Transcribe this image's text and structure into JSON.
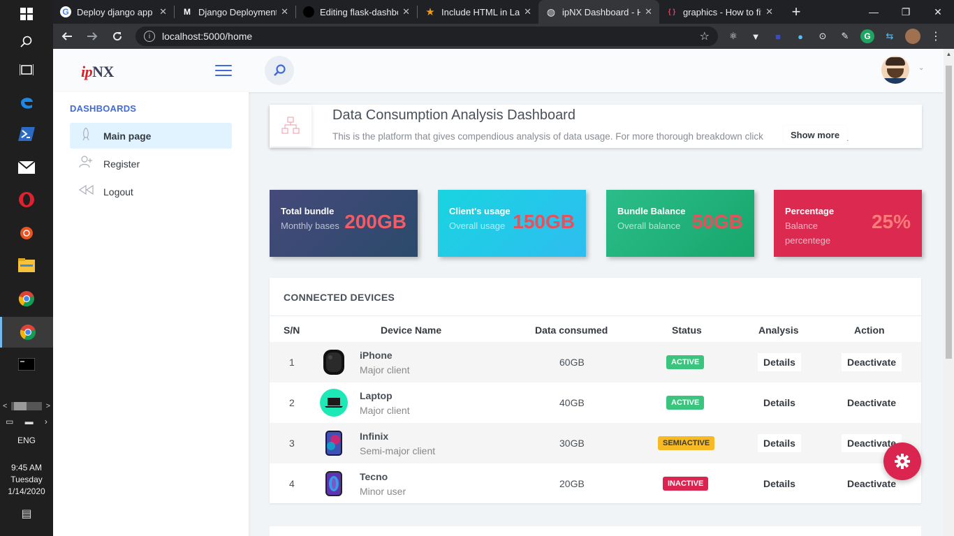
{
  "taskbar": {
    "icons": [
      "windows-icon",
      "search-icon",
      "task-view-icon",
      "edge-icon",
      "powershell-icon",
      "mail-icon",
      "opera-icon",
      "ubuntu-icon",
      "file-explorer-icon",
      "chrome-icon",
      "chrome-active-icon",
      "terminal-icon"
    ],
    "language": "ENG",
    "time": "9:45 AM",
    "day": "Tuesday",
    "date": "1/14/2020"
  },
  "browser": {
    "tabs": [
      {
        "label": "Deploy django app w",
        "favicon": "G"
      },
      {
        "label": "Django Deployment (",
        "favicon": "M"
      },
      {
        "label": "Editing flask-dashbo",
        "favicon": "github"
      },
      {
        "label": "Include HTML in LaTe",
        "favicon": "star"
      },
      {
        "label": "ipNX Dashboard - Ho",
        "favicon": "globe",
        "active": true
      },
      {
        "label": "graphics - How to fit",
        "favicon": "{ }"
      }
    ],
    "url": "localhost:5000/home"
  },
  "app": {
    "logo_part1": "ip",
    "logo_part2": "NX",
    "sidebar": {
      "heading": "DASHBOARDS",
      "items": [
        {
          "label": "Main page",
          "icon": "rocket-icon",
          "active": true
        },
        {
          "label": "Register",
          "icon": "add-user-icon"
        },
        {
          "label": "Logout",
          "icon": "rewind-icon"
        }
      ]
    },
    "title_card": {
      "title": "Data Consumption Analysis Dashboard",
      "subtitle": "This is the platform that gives compendious analysis of data usage. For more thorough breakdown click",
      "show_more": "Show more",
      "trailing": "."
    },
    "stats": [
      {
        "title": "Total bundle",
        "subtitle": "Monthly bases",
        "value": "200GB"
      },
      {
        "title": "Client's usage",
        "subtitle": "Overall usage",
        "value": "150GB"
      },
      {
        "title": "Bundle Balance",
        "subtitle": "Overall balance",
        "value": "50GB"
      },
      {
        "title": "Percentage",
        "subtitle": "Balance percentege",
        "value": "25%"
      }
    ],
    "devices": {
      "title": "CONNECTED DEVICES",
      "headers": [
        "S/N",
        "Device Name",
        "Data consumed",
        "Status",
        "Analysis",
        "Action"
      ],
      "rows": [
        {
          "sn": "1",
          "name": "iPhone",
          "sub": "Major client",
          "data": "60GB",
          "status": "ACTIVE",
          "analysis": "Details",
          "action": "Deactivate"
        },
        {
          "sn": "2",
          "name": "Laptop",
          "sub": "Major client",
          "data": "40GB",
          "status": "ACTIVE",
          "analysis": "Details",
          "action": "Deactivate"
        },
        {
          "sn": "3",
          "name": "Infinix",
          "sub": "Semi-major client",
          "data": "30GB",
          "status": "SEMIACTIVE",
          "analysis": "Details",
          "action": "Deactivate"
        },
        {
          "sn": "4",
          "name": "Tecno",
          "sub": "Minor user",
          "data": "20GB",
          "status": "INACTIVE",
          "analysis": "Details",
          "action": "Deactivate"
        }
      ]
    }
  }
}
